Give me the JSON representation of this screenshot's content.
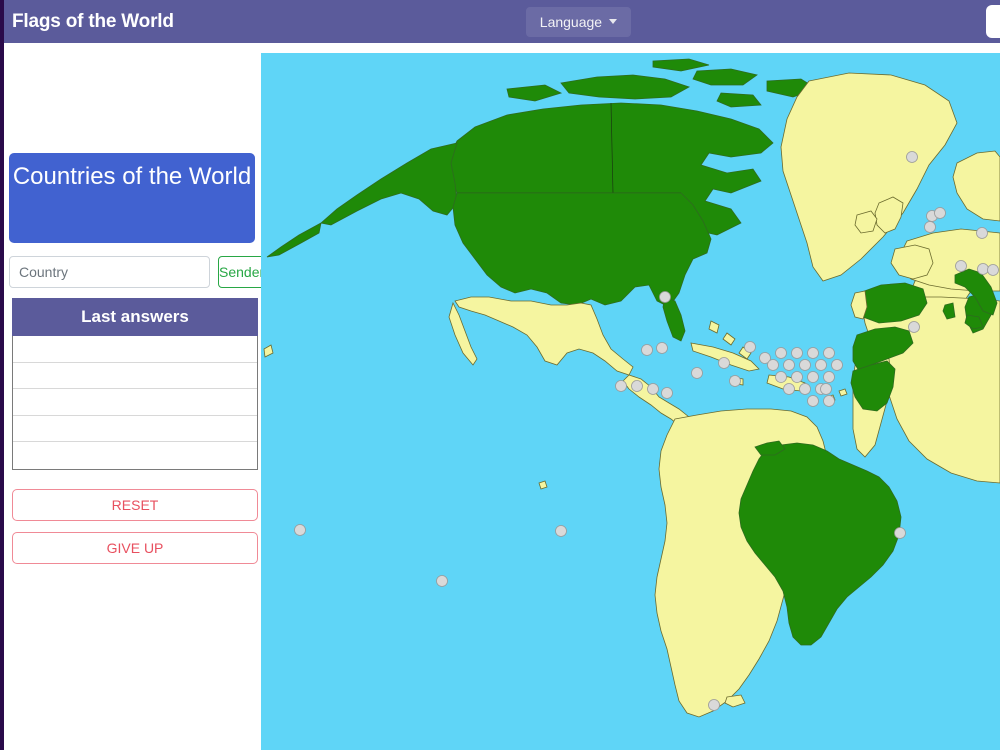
{
  "navbar": {
    "brand": "Flags of the World",
    "language_button": "Language",
    "caret_icon": "chevron-down-icon",
    "background_color": "#5b5b9b"
  },
  "sidebar": {
    "quiz_title": "Countries of the World",
    "quiz_title_color": "#4162d0",
    "input": {
      "placeholder": "Country",
      "value": ""
    },
    "submit_button": "Senden",
    "submit_button_color": "#28a745",
    "answers_panel": {
      "header": "Last answers",
      "header_color": "#5b5b9b",
      "rows": [
        "",
        "",
        "",
        "",
        ""
      ]
    },
    "reset_button": "RESET",
    "give_up_button": "GIVE UP",
    "action_button_color": "#e8505f"
  },
  "map": {
    "ocean_color": "#5fd5f7",
    "guessed_color": "#1f8a08",
    "unguessed_color": "#f5f5a0",
    "marker_color": "#d9d9d9",
    "border_color": "#2e6b1f",
    "guessed_countries": [
      "Canada",
      "United States",
      "Brazil",
      "Spain",
      "Morocco",
      "Western Sahara",
      "Italy",
      "Tunisia"
    ],
    "unguessed_visible_countries": [
      "Mexico",
      "Greenland",
      "Iceland",
      "Guatemala",
      "Belize",
      "Honduras",
      "El Salvador",
      "Nicaragua",
      "Costa Rica",
      "Panama",
      "Cuba",
      "Colombia",
      "Venezuela",
      "Guyana",
      "Suriname",
      "French Guiana",
      "Ecuador",
      "Peru",
      "Bolivia",
      "Paraguay",
      "Chile",
      "Argentina",
      "Uruguay",
      "Portugal",
      "France",
      "United Kingdom",
      "Ireland",
      "Norway",
      "Algeria",
      "Mauritania",
      "Mali",
      "Niger",
      "Senegal"
    ],
    "island_marker_count": 38
  }
}
